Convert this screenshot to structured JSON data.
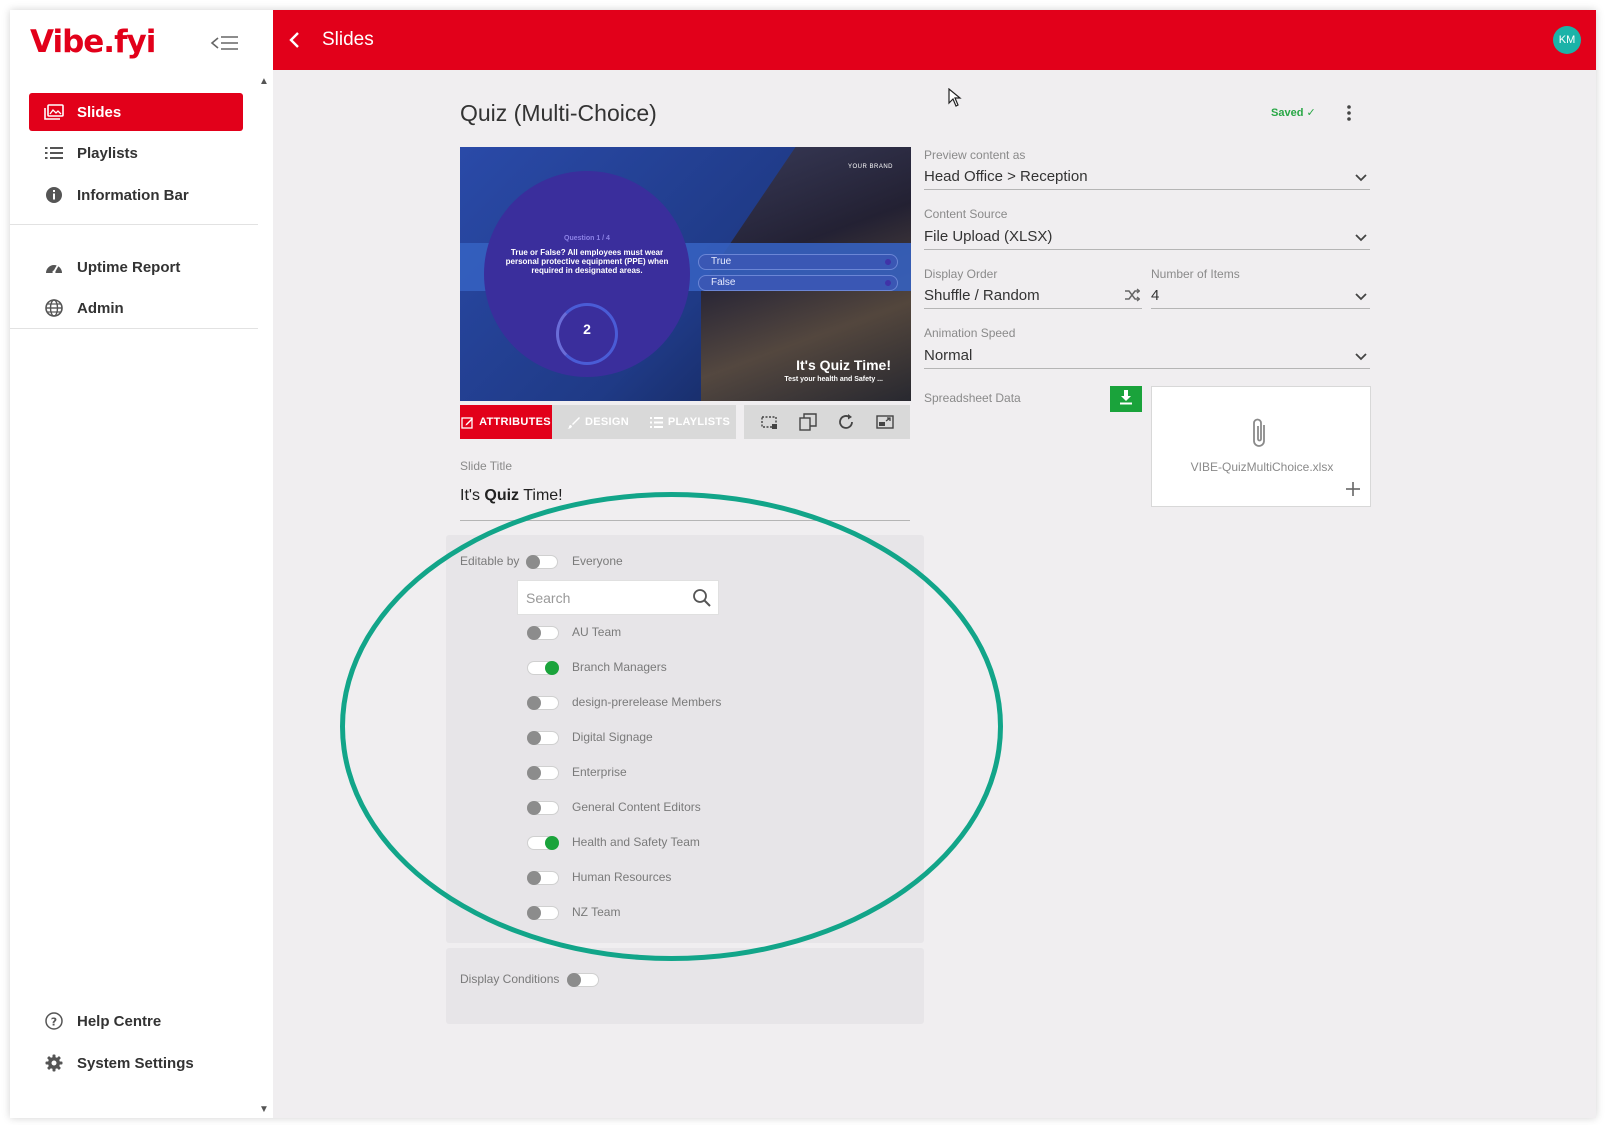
{
  "sidebar": {
    "logo": "Vibe.fyi",
    "items": [
      {
        "label": "Slides",
        "icon": "slides-icon"
      },
      {
        "label": "Playlists",
        "icon": "list-icon"
      },
      {
        "label": "Information Bar",
        "icon": "info-icon"
      },
      {
        "label": "Uptime Report",
        "icon": "gauge-icon"
      },
      {
        "label": "Admin",
        "icon": "globe-icon"
      }
    ],
    "bottom_items": [
      {
        "label": "Help Centre",
        "icon": "help-icon"
      },
      {
        "label": "System Settings",
        "icon": "gear-icon"
      }
    ]
  },
  "topbar": {
    "title": "Slides",
    "avatar": "KM"
  },
  "slide": {
    "name": "Quiz (Multi-Choice)",
    "status": "Saved",
    "preview": {
      "question_number": "Question 1 / 4",
      "question": "True or False? All employees must wear personal protective equipment (PPE) when required in designated areas.",
      "timer": "2",
      "answers": [
        "True",
        "False"
      ],
      "brand": "YOUR BRAND",
      "title": "It's Quiz Time!",
      "subtitle": "Test your health and Safety ..."
    },
    "tabs": {
      "attributes": "ATTRIBUTES",
      "design": "DESIGN",
      "playlists": "PLAYLISTS"
    },
    "slide_title_label": "Slide Title",
    "slide_title_pre": "It's ",
    "slide_title_bold": "Quiz",
    "slide_title_post": " Time!"
  },
  "settings": {
    "preview_as_label": "Preview content as",
    "preview_as_value": "Head Office > Reception",
    "content_source_label": "Content Source",
    "content_source_value": "File Upload (XLSX)",
    "display_order_label": "Display Order",
    "display_order_value": "Shuffle / Random",
    "number_items_label": "Number of Items",
    "number_items_value": "4",
    "animation_speed_label": "Animation Speed",
    "animation_speed_value": "Normal",
    "spreadsheet_label": "Spreadsheet Data",
    "file_name": "VIBE-QuizMultiChoice.xlsx"
  },
  "editable": {
    "label": "Editable by",
    "everyone_label": "Everyone",
    "everyone_on": false,
    "search_placeholder": "Search",
    "groups": [
      {
        "name": "AU Team",
        "on": false
      },
      {
        "name": "Branch Managers",
        "on": true
      },
      {
        "name": "design-prerelease Members",
        "on": false
      },
      {
        "name": "Digital Signage",
        "on": false
      },
      {
        "name": "Enterprise",
        "on": false
      },
      {
        "name": "General Content Editors",
        "on": false
      },
      {
        "name": "Health and Safety Team",
        "on": true
      },
      {
        "name": "Human Resources",
        "on": false
      },
      {
        "name": "NZ Team",
        "on": false
      }
    ]
  },
  "display_conditions": {
    "label": "Display Conditions",
    "on": false
  },
  "colors": {
    "brand_red": "#e2001a",
    "toggle_on": "#1aa33b",
    "highlight_ring": "#12a589",
    "avatar": "#1bb3a8"
  }
}
